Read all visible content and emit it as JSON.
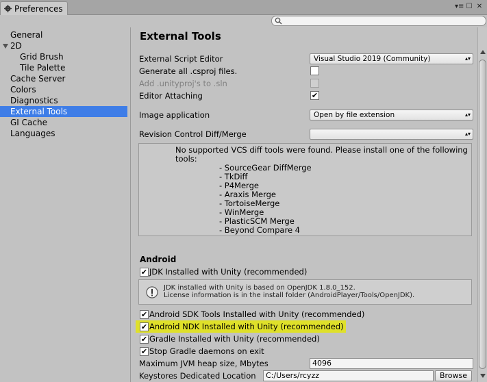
{
  "window": {
    "tab_title": "Preferences",
    "buttons": {
      "menu": "▾≡",
      "maximize": "☐",
      "close": "✕"
    }
  },
  "search": {
    "value": "",
    "placeholder": ""
  },
  "sidebar": {
    "items": [
      {
        "label": "General"
      },
      {
        "label": "2D"
      },
      {
        "label": "Grid Brush"
      },
      {
        "label": "Tile Palette"
      },
      {
        "label": "Cache Server"
      },
      {
        "label": "Colors"
      },
      {
        "label": "Diagnostics"
      },
      {
        "label": "External Tools"
      },
      {
        "label": "GI Cache"
      },
      {
        "label": "Languages"
      }
    ],
    "selected": "External Tools"
  },
  "main": {
    "title": "External Tools",
    "script_editor": {
      "label": "External Script Editor",
      "value": "Visual Studio 2019 (Community)"
    },
    "generate_csproj": {
      "label": "Generate all .csproj files.",
      "checked": false
    },
    "add_unityproj": {
      "label": "Add .unityproj's to .sln",
      "checked": false,
      "disabled": true
    },
    "editor_attaching": {
      "label": "Editor Attaching",
      "checked": true
    },
    "image_app": {
      "label": "Image application",
      "value": "Open by file extension"
    },
    "revision_diff": {
      "label": "Revision Control Diff/Merge",
      "value": ""
    },
    "vcs_message": "No supported VCS diff tools were found. Please install one of the following tools:",
    "vcs_tools": [
      "- SourceGear DiffMerge",
      "- TkDiff",
      "- P4Merge",
      "- Araxis Merge",
      "- TortoiseMerge",
      "- WinMerge",
      "- PlasticSCM Merge",
      "- Beyond Compare 4"
    ]
  },
  "android": {
    "section_title": "Android",
    "jdk": {
      "label": "JDK Installed with Unity (recommended)",
      "checked": true
    },
    "jdk_info_line1": "JDK installed with Unity is based on OpenJDK 1.8.0_152.",
    "jdk_info_line2": "License information is in the install folder (AndroidPlayer/Tools/OpenJDK).",
    "sdk": {
      "label": "Android SDK Tools Installed with Unity (recommended)",
      "checked": true
    },
    "ndk": {
      "label": "Android NDK Installed with Unity (recommended)",
      "checked": true,
      "highlight_color": "#dfe02a"
    },
    "gradle": {
      "label": "Gradle Installed with Unity (recommended)",
      "checked": true
    },
    "stop_gradle": {
      "label": "Stop Gradle daemons on exit",
      "checked": true
    },
    "jvm_heap": {
      "label": "Maximum JVM heap size, Mbytes",
      "value": "4096"
    },
    "keystores": {
      "label": "Keystores Dedicated Location",
      "value": "C:/Users/rcyzz",
      "button": "Browse"
    }
  },
  "colors": {
    "selection": "#3e7de7",
    "highlight": "#dfe02a",
    "panel": "#c2c2c2"
  }
}
